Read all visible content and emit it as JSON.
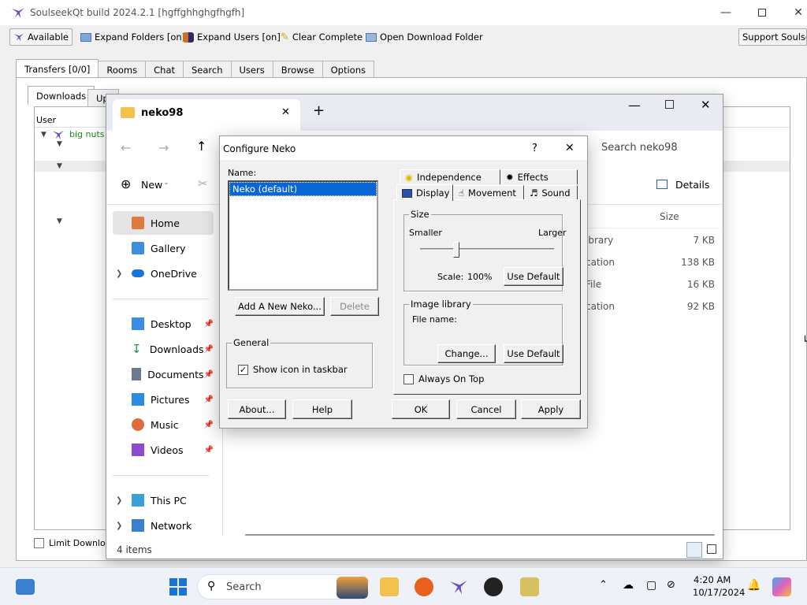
{
  "slsk": {
    "title": "SoulseekQt build 2024.2.1 [hgffghhghgfhgfh]",
    "toolbar": {
      "status": "Available",
      "expand_folders": "Expand Folders [on]",
      "expand_users": "Expand Users [on]",
      "clear_complete": "Clear Complete",
      "open_download_folder": "Open Download Folder",
      "support": "Support Soulseek"
    },
    "tabs": [
      "Transfers [0/0]",
      "Rooms",
      "Chat",
      "Search",
      "Users",
      "Browse",
      "Options"
    ],
    "subtabs": [
      "Downloads",
      "Uploads"
    ],
    "col_user": "User",
    "row_user": "big nuts",
    "limit_download": "Limit Download"
  },
  "explorer": {
    "tab_title": "neko98",
    "search_placeholder": "Search neko98",
    "new_label": "New",
    "details_label": "Details",
    "col_size": "Size",
    "files": [
      {
        "type": "ibrary",
        "size": "7 KB"
      },
      {
        "type": "cation",
        "size": "138 KB"
      },
      {
        "type": "File",
        "size": "16 KB"
      },
      {
        "type": "cation",
        "size": "92 KB"
      }
    ],
    "nav": {
      "home": "Home",
      "gallery": "Gallery",
      "onedrive": "OneDrive",
      "desktop": "Desktop",
      "downloads": "Downloads",
      "documents": "Documents",
      "pictures": "Pictures",
      "music": "Music",
      "videos": "Videos",
      "thispc": "This PC",
      "network": "Network"
    },
    "status": "4 items"
  },
  "dialog": {
    "title": "Configure Neko",
    "help_glyph": "?",
    "name_label": "Name:",
    "neko_item": "Neko (default)",
    "add_button": "Add A New Neko...",
    "delete_button": "Delete",
    "general_label": "General",
    "show_icon_label": "Show icon in taskbar",
    "show_icon_checked": true,
    "about_button": "About...",
    "help_button": "Help",
    "tabs_back": [
      "Independence",
      "Effects"
    ],
    "tabs_front": [
      "Display",
      "Movement",
      "Sound"
    ],
    "size_group": "Size",
    "smaller": "Smaller",
    "larger": "Larger",
    "scale_label": "Scale:",
    "scale_value": "100%",
    "slider_fraction": 0.27,
    "use_default": "Use Default",
    "image_library_group": "Image library",
    "file_name_label": "File name:",
    "change_button": "Change...",
    "always_on_top": "Always On Top",
    "ok": "OK",
    "cancel": "Cancel",
    "apply": "Apply"
  },
  "taskbar": {
    "search_placeholder": "Search",
    "time": "4:20 AM",
    "date": "10/17/2024"
  }
}
